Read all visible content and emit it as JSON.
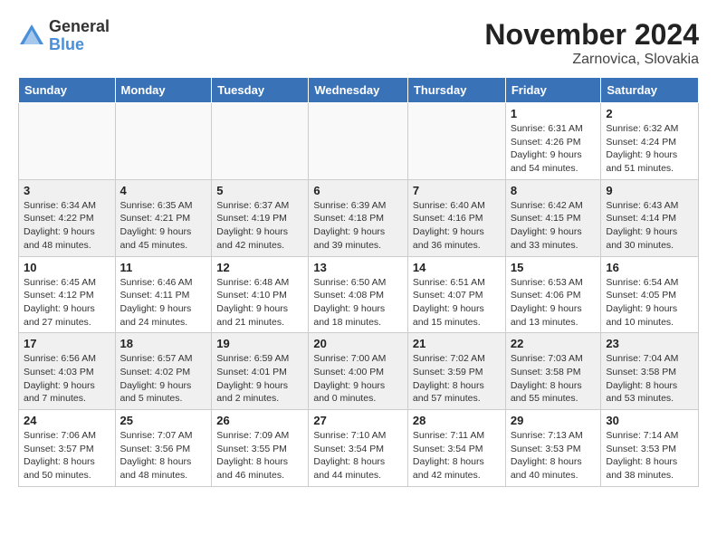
{
  "logo": {
    "general": "General",
    "blue": "Blue"
  },
  "title": "November 2024",
  "location": "Zarnovica, Slovakia",
  "days_of_week": [
    "Sunday",
    "Monday",
    "Tuesday",
    "Wednesday",
    "Thursday",
    "Friday",
    "Saturday"
  ],
  "weeks": [
    [
      {
        "day": "",
        "info": ""
      },
      {
        "day": "",
        "info": ""
      },
      {
        "day": "",
        "info": ""
      },
      {
        "day": "",
        "info": ""
      },
      {
        "day": "",
        "info": ""
      },
      {
        "day": "1",
        "info": "Sunrise: 6:31 AM\nSunset: 4:26 PM\nDaylight: 9 hours\nand 54 minutes."
      },
      {
        "day": "2",
        "info": "Sunrise: 6:32 AM\nSunset: 4:24 PM\nDaylight: 9 hours\nand 51 minutes."
      }
    ],
    [
      {
        "day": "3",
        "info": "Sunrise: 6:34 AM\nSunset: 4:22 PM\nDaylight: 9 hours\nand 48 minutes."
      },
      {
        "day": "4",
        "info": "Sunrise: 6:35 AM\nSunset: 4:21 PM\nDaylight: 9 hours\nand 45 minutes."
      },
      {
        "day": "5",
        "info": "Sunrise: 6:37 AM\nSunset: 4:19 PM\nDaylight: 9 hours\nand 42 minutes."
      },
      {
        "day": "6",
        "info": "Sunrise: 6:39 AM\nSunset: 4:18 PM\nDaylight: 9 hours\nand 39 minutes."
      },
      {
        "day": "7",
        "info": "Sunrise: 6:40 AM\nSunset: 4:16 PM\nDaylight: 9 hours\nand 36 minutes."
      },
      {
        "day": "8",
        "info": "Sunrise: 6:42 AM\nSunset: 4:15 PM\nDaylight: 9 hours\nand 33 minutes."
      },
      {
        "day": "9",
        "info": "Sunrise: 6:43 AM\nSunset: 4:14 PM\nDaylight: 9 hours\nand 30 minutes."
      }
    ],
    [
      {
        "day": "10",
        "info": "Sunrise: 6:45 AM\nSunset: 4:12 PM\nDaylight: 9 hours\nand 27 minutes."
      },
      {
        "day": "11",
        "info": "Sunrise: 6:46 AM\nSunset: 4:11 PM\nDaylight: 9 hours\nand 24 minutes."
      },
      {
        "day": "12",
        "info": "Sunrise: 6:48 AM\nSunset: 4:10 PM\nDaylight: 9 hours\nand 21 minutes."
      },
      {
        "day": "13",
        "info": "Sunrise: 6:50 AM\nSunset: 4:08 PM\nDaylight: 9 hours\nand 18 minutes."
      },
      {
        "day": "14",
        "info": "Sunrise: 6:51 AM\nSunset: 4:07 PM\nDaylight: 9 hours\nand 15 minutes."
      },
      {
        "day": "15",
        "info": "Sunrise: 6:53 AM\nSunset: 4:06 PM\nDaylight: 9 hours\nand 13 minutes."
      },
      {
        "day": "16",
        "info": "Sunrise: 6:54 AM\nSunset: 4:05 PM\nDaylight: 9 hours\nand 10 minutes."
      }
    ],
    [
      {
        "day": "17",
        "info": "Sunrise: 6:56 AM\nSunset: 4:03 PM\nDaylight: 9 hours\nand 7 minutes."
      },
      {
        "day": "18",
        "info": "Sunrise: 6:57 AM\nSunset: 4:02 PM\nDaylight: 9 hours\nand 5 minutes."
      },
      {
        "day": "19",
        "info": "Sunrise: 6:59 AM\nSunset: 4:01 PM\nDaylight: 9 hours\nand 2 minutes."
      },
      {
        "day": "20",
        "info": "Sunrise: 7:00 AM\nSunset: 4:00 PM\nDaylight: 9 hours\nand 0 minutes."
      },
      {
        "day": "21",
        "info": "Sunrise: 7:02 AM\nSunset: 3:59 PM\nDaylight: 8 hours\nand 57 minutes."
      },
      {
        "day": "22",
        "info": "Sunrise: 7:03 AM\nSunset: 3:58 PM\nDaylight: 8 hours\nand 55 minutes."
      },
      {
        "day": "23",
        "info": "Sunrise: 7:04 AM\nSunset: 3:58 PM\nDaylight: 8 hours\nand 53 minutes."
      }
    ],
    [
      {
        "day": "24",
        "info": "Sunrise: 7:06 AM\nSunset: 3:57 PM\nDaylight: 8 hours\nand 50 minutes."
      },
      {
        "day": "25",
        "info": "Sunrise: 7:07 AM\nSunset: 3:56 PM\nDaylight: 8 hours\nand 48 minutes."
      },
      {
        "day": "26",
        "info": "Sunrise: 7:09 AM\nSunset: 3:55 PM\nDaylight: 8 hours\nand 46 minutes."
      },
      {
        "day": "27",
        "info": "Sunrise: 7:10 AM\nSunset: 3:54 PM\nDaylight: 8 hours\nand 44 minutes."
      },
      {
        "day": "28",
        "info": "Sunrise: 7:11 AM\nSunset: 3:54 PM\nDaylight: 8 hours\nand 42 minutes."
      },
      {
        "day": "29",
        "info": "Sunrise: 7:13 AM\nSunset: 3:53 PM\nDaylight: 8 hours\nand 40 minutes."
      },
      {
        "day": "30",
        "info": "Sunrise: 7:14 AM\nSunset: 3:53 PM\nDaylight: 8 hours\nand 38 minutes."
      }
    ]
  ]
}
